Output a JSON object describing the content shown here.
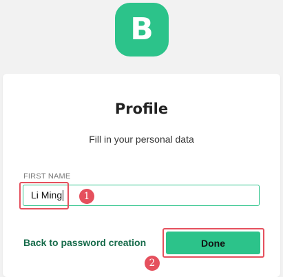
{
  "logo": {
    "letter": "B",
    "color": "#2cc38a"
  },
  "profile": {
    "title": "Profile",
    "subtitle": "Fill in your personal data",
    "first_name_label": "FIRST NAME",
    "first_name_value": "Li Ming"
  },
  "actions": {
    "back_label": "Back to password creation",
    "done_label": "Done"
  },
  "annotations": {
    "marker_1": "1",
    "marker_2": "2",
    "highlight_color": "#e5505d"
  }
}
